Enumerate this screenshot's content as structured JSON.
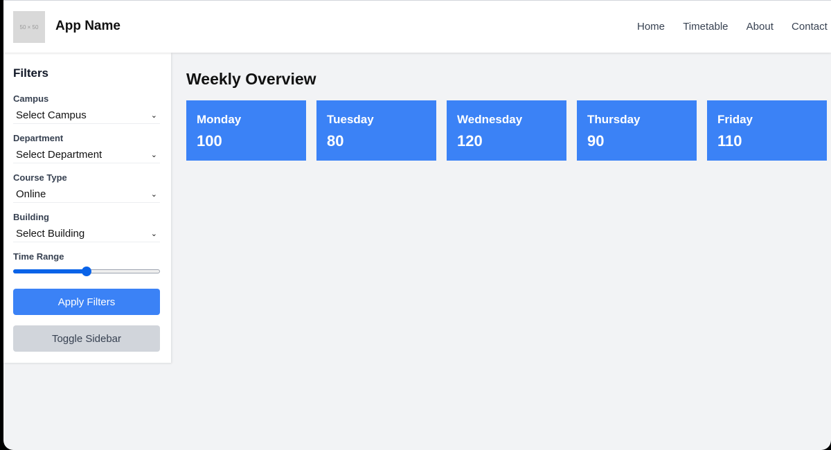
{
  "header": {
    "logo_text": "50 × 50",
    "app_name": "App Name",
    "nav": [
      "Home",
      "Timetable",
      "About",
      "Contact"
    ]
  },
  "sidebar": {
    "title": "Filters",
    "filters": [
      {
        "label": "Campus",
        "value": "Select Campus"
      },
      {
        "label": "Department",
        "value": "Select Department"
      },
      {
        "label": "Course Type",
        "value": "Online"
      },
      {
        "label": "Building",
        "value": "Select Building"
      }
    ],
    "time_range": {
      "label": "Time Range",
      "value_fraction": 0.5
    },
    "apply_label": "Apply Filters",
    "toggle_label": "Toggle Sidebar"
  },
  "main": {
    "title": "Weekly Overview",
    "cards": [
      {
        "day": "Monday",
        "value": "100"
      },
      {
        "day": "Tuesday",
        "value": "80"
      },
      {
        "day": "Wednesday",
        "value": "120"
      },
      {
        "day": "Thursday",
        "value": "90"
      },
      {
        "day": "Friday",
        "value": "110"
      }
    ]
  },
  "colors": {
    "accent": "#3b82f6",
    "slider": "#0a63e8",
    "secondary_button": "#d1d5db",
    "background": "#f2f3f5"
  },
  "icons": {
    "select_chevron": "chevron-down-icon"
  }
}
